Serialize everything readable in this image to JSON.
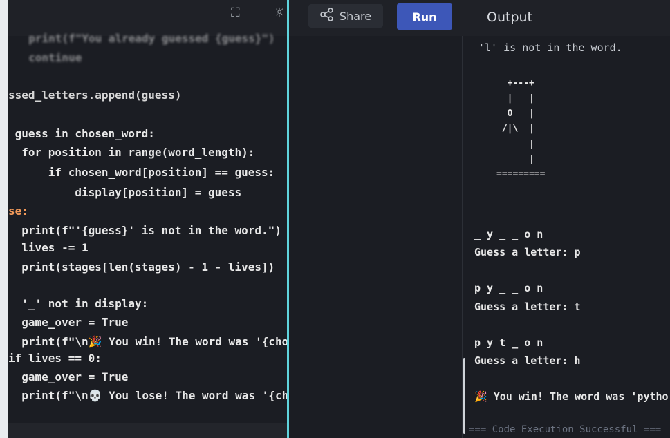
{
  "toolbar": {
    "share_label": "Share",
    "run_label": "Run",
    "output_title": "Output",
    "fullscreen_icon": "fullscreen-icon",
    "theme_icon": "theme-icon",
    "share_icon": "share-icon"
  },
  "editor": {
    "line_blurred_a": "  print(f\"You already guessed {guess}\")",
    "line_blurred_b": "  continue",
    "line_append": "ssed_letters.append(guess)",
    "line_if": " guess in chosen_word:",
    "line_for": "  for position in range(word_length):",
    "line_if_pos": "      if chosen_word[position] == guess:",
    "line_display": "          display[position] = guess",
    "line_else": "se:",
    "line_print_notin": "  print(f\"'{guess}' is not in the word.\")",
    "line_lives": "  lives -= 1",
    "line_stages": "  print(stages[len(stages) - 1 - lives])",
    "line_if_display": "  '_' not in display:",
    "line_game_over_1": "  game_over = True",
    "line_win": "  print(f\"\\n🎉 You win! The word was '{chosen_word}'.\")",
    "line_elif": "if lives == 0:",
    "line_game_over_2": "  game_over = True",
    "line_lose": "  print(f\"\\n💀 You lose! The word was '{chosen_word}'.\")"
  },
  "output": {
    "not_in_word": "'l' is not in the word.",
    "hangman_art": "  +---+\n  |   |\n  O   |\n /|\\  |\n      |\n      |\n=========",
    "display_1": "_ y _ _ o n",
    "prompt_1": "Guess a letter: p",
    "display_2": "p y _ _ o n",
    "prompt_2": "Guess a letter: t",
    "display_3": "p y t _ o n",
    "prompt_3": "Guess a letter: h",
    "win_message": "🎉 You win! The word was 'pytho",
    "footer": "=== Code Execution Successful ==="
  },
  "colors": {
    "run_button": "#3d57b8",
    "divider": "#5fd3dc",
    "keyword": "#f39a5a",
    "background": "#1b1d23"
  }
}
